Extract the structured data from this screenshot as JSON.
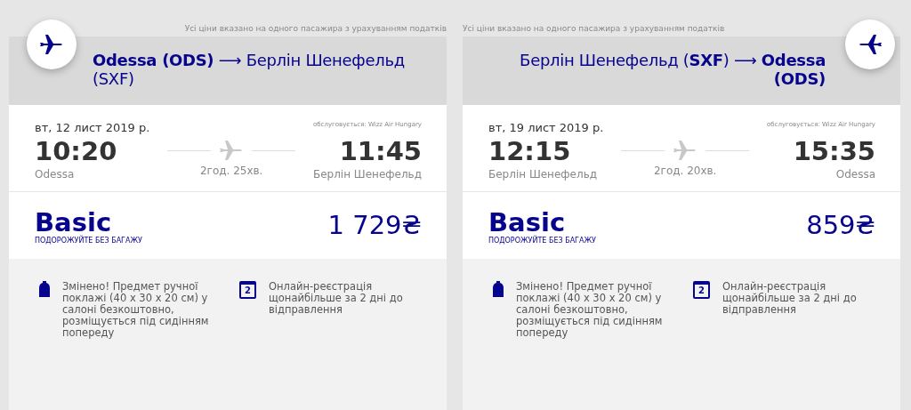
{
  "flights": [
    {
      "kind": "outbound",
      "note": "Усі ціни вказано на одного пасажира з урахуванням податків",
      "route": "**Odessa (ODS)** ⟶ Берлін Шенефельд (SXF)",
      "date": "вт, 12 лист 2019 р.",
      "operator": "обслуговується: Wizz Air Hungary",
      "depart_time": "10:20",
      "depart_city": "Odessa",
      "duration": "2год. 25хв.",
      "arrive_time": "11:45",
      "arrive_city": "Берлін Шенефельд",
      "fare": "Basic",
      "fare_note": "ПОДОРОЖУЙТЕ БЕЗ БАГАЖУ",
      "price": "1 729₴",
      "features": [
        {
          "kind": "bag",
          "text": "Змінено! Предмет ручної поклажі (40 x 30 x 20 см) у салоні безкоштовно, розміщується під сидінням попереду"
        },
        {
          "kind": "calendar",
          "icon_text": "2",
          "text": "Онлайн-реєстрація щонайбільше за 2 дні до відправлення"
        }
      ]
    },
    {
      "kind": "return",
      "note": "Усі ціни вказано на одного пасажира з урахуванням податків",
      "route": "Берлін Шенефельд (**SXF**) ⟶ **Odessa (ODS)**",
      "date": "вт, 19 лист 2019 р.",
      "operator": "обслуговується: Wizz Air Hungary",
      "depart_time": "12:15",
      "depart_city": "Берлін Шенефельд",
      "duration": "2год. 20хв.",
      "arrive_time": "15:35",
      "arrive_city": "Odessa",
      "fare": "Basic",
      "fare_note": "ПОДОРОЖУЙТЕ БЕЗ БАГАЖУ",
      "price": "859₴",
      "features": [
        {
          "kind": "bag",
          "text": "Змінено! Предмет ручної поклажі (40 x 30 x 20 см) у салоні безкоштовно, розміщується під сидінням попереду"
        },
        {
          "kind": "calendar",
          "icon_text": "2",
          "text": "Онлайн-реєстрація щонайбільше за 2 дні до відправлення"
        }
      ]
    }
  ]
}
